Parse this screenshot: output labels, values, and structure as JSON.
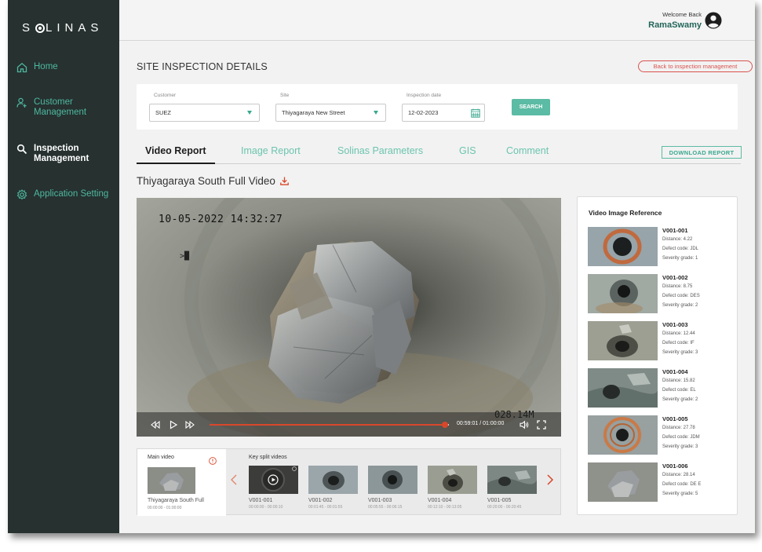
{
  "brand": {
    "logo": "SOLINAS"
  },
  "sidebar": {
    "items": [
      {
        "label": "Home",
        "icon": "home-icon"
      },
      {
        "label": "Customer Management",
        "icon": "user-add-icon"
      },
      {
        "label": "Inspection Management",
        "icon": "search-icon",
        "active": true
      },
      {
        "label": "Application Setting",
        "icon": "gear-icon"
      }
    ]
  },
  "header": {
    "welcome": "Welcome Back",
    "username": "RamaSwamy"
  },
  "page": {
    "title": "SITE INSPECTION DETAILS",
    "back_label": "Back to inspection management"
  },
  "filters": {
    "customer_label": "Customer",
    "customer_value": "SUEZ",
    "site_label": "Site",
    "site_value": "Thiyagaraya New Street",
    "date_label": "Inspection date",
    "date_value": "12-02-2023",
    "search_label": "SEARCH"
  },
  "tabs": [
    {
      "label": "Video Report",
      "active": true
    },
    {
      "label": "Image Report"
    },
    {
      "label": "Solinas Parameters"
    },
    {
      "label": "GIS"
    },
    {
      "label": "Comment"
    }
  ],
  "download_report_label": "DOWNLOAD REPORT",
  "video": {
    "title": "Thiyagaraya South Full Video",
    "overlay_timestamp": "10-05-2022 14:32:27",
    "overlay_distance": "028.14M",
    "overlay_marker": ">█",
    "time_display": "00:59:01 / 01:00:00",
    "progress": 0.983
  },
  "strip": {
    "main_label": "Main video",
    "main_name": "Thiyagaraya South Full",
    "main_time": "00:00:00 - 01:00:00",
    "split_label": "Key split videos",
    "splits": [
      {
        "name": "V001-001",
        "time": "00:00:00 - 00:00:10"
      },
      {
        "name": "V001-002",
        "time": "00:01:45 - 00:01:55"
      },
      {
        "name": "V001-003",
        "time": "00:05:55 - 00:06:15"
      },
      {
        "name": "V001-004",
        "time": "00:12:10 - 00:13:05"
      },
      {
        "name": "V001-005",
        "time": "00:20:00 - 00:20:45"
      }
    ]
  },
  "reference": {
    "title": "Video Image Reference",
    "items": [
      {
        "id": "V001-001",
        "distance": "Distance: 4.22",
        "defect": "Defect code: JDL",
        "severity": "Severity grade: 1"
      },
      {
        "id": "V001-002",
        "distance": "Distance: 8.75",
        "defect": "Defect code: DES",
        "severity": "Severity grade: 2"
      },
      {
        "id": "V001-003",
        "distance": "Distance: 12.44",
        "defect": "Defect code: IF",
        "severity": "Severity grade: 3"
      },
      {
        "id": "V001-004",
        "distance": "Distance: 15.82",
        "defect": "Defect code: EL",
        "severity": "Severity grade: 2"
      },
      {
        "id": "V001-005",
        "distance": "Distance: 27.78",
        "defect": "Defect code: JDM",
        "severity": "Severity grade: 3"
      },
      {
        "id": "V001-006",
        "distance": "Distance: 28.14",
        "defect": "Defect code: DE E",
        "severity": "Severity grade: 5"
      }
    ]
  },
  "colors": {
    "sidebar": "#263130",
    "accent": "#4fb8a0",
    "danger": "#d9534f",
    "progress": "#d9472b"
  }
}
